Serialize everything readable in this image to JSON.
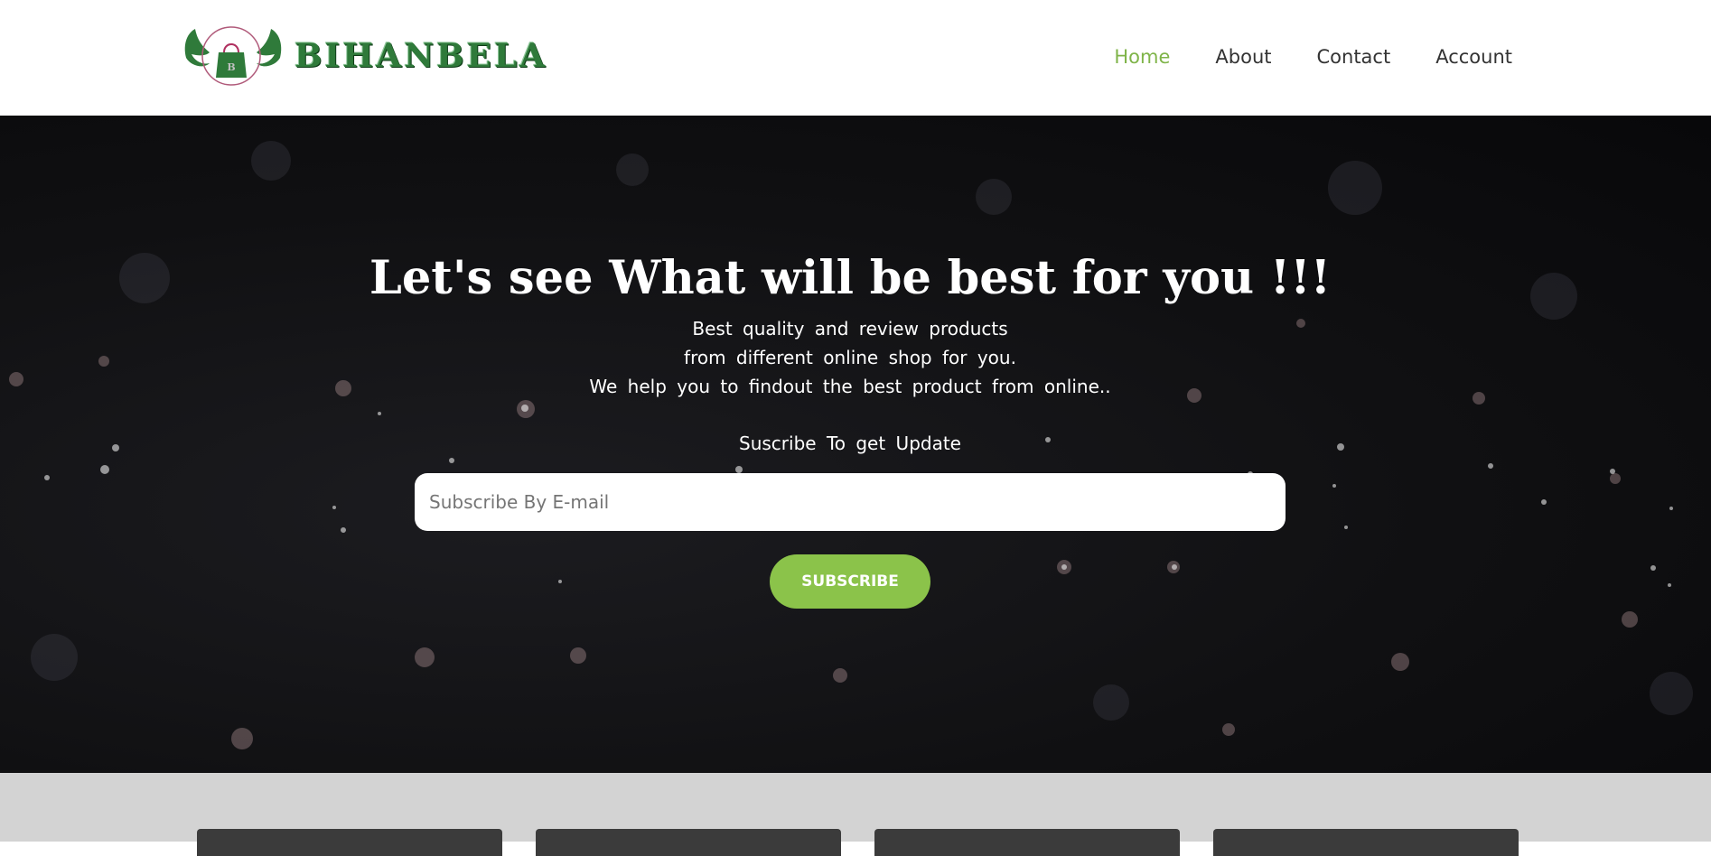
{
  "header": {
    "logo_text": "BIHANBELA",
    "nav": [
      {
        "label": "Home",
        "active": true
      },
      {
        "label": "About",
        "active": false
      },
      {
        "label": "Contact",
        "active": false
      },
      {
        "label": "Account",
        "active": false
      }
    ]
  },
  "hero": {
    "title": "Let's see What will be best for you !!!",
    "subtitle_lines": [
      "Best quality and review products",
      "from different online shop for you.",
      "We help you to findout the best product from online.."
    ],
    "cta_text": "Suscribe To get Update",
    "email_placeholder": "Subscribe By E-mail",
    "email_value": "",
    "subscribe_label": "SUBSCRIBE"
  },
  "colors": {
    "accent": "#8bc34a",
    "nav_active": "#7fb449",
    "nav_text": "#333333",
    "hero_bg": "#101012",
    "bottom_bg": "#d3d3d3",
    "card_bg": "#3b3b3b",
    "logo_green": "#2f7a3a"
  },
  "icons": {
    "logo": "shopping-bag-wings-logo-icon"
  }
}
